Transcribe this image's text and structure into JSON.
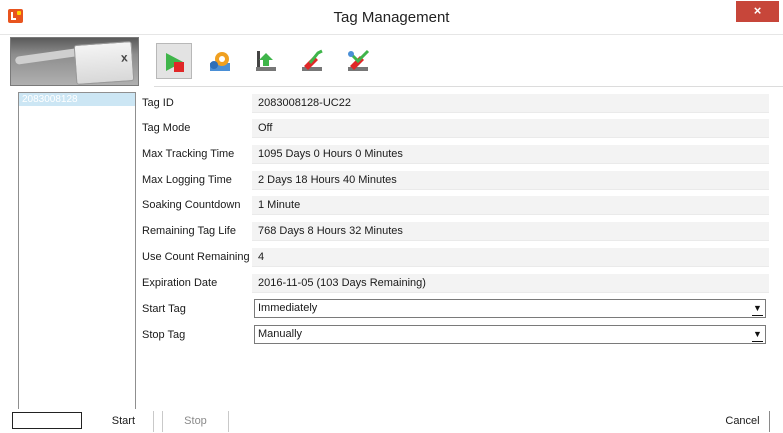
{
  "window": {
    "title": "Tag Management",
    "close_label": "×"
  },
  "toolbar": {
    "buttons": [
      {
        "name": "start-stop-tag-icon",
        "active": true
      },
      {
        "name": "configure-tag-icon",
        "active": false
      },
      {
        "name": "download-data-icon",
        "active": false
      },
      {
        "name": "clear-data-icon",
        "active": false
      },
      {
        "name": "reset-tag-icon",
        "active": false
      }
    ]
  },
  "tag_list": {
    "items": [
      "2083008128"
    ]
  },
  "properties": [
    {
      "label": "Tag ID",
      "value": "2083008128-UC22"
    },
    {
      "label": "Tag Mode",
      "value": "Off"
    },
    {
      "label": "Max Tracking Time",
      "value": "1095 Days 0 Hours 0 Minutes"
    },
    {
      "label": "Max Logging Time",
      "value": "2 Days 18 Hours 40 Minutes"
    },
    {
      "label": "Soaking Countdown",
      "value": "1 Minute"
    },
    {
      "label": "Remaining Tag Life",
      "value": "768 Days 8 Hours 32 Minutes"
    },
    {
      "label": "Use Count Remaining",
      "value": "4"
    },
    {
      "label": "Expiration Date",
      "value": "2016-11-05 (103 Days Remaining)"
    }
  ],
  "selects": {
    "start_tag": {
      "label": "Start Tag",
      "value": "Immediately"
    },
    "stop_tag": {
      "label": "Stop Tag",
      "value": "Manually"
    }
  },
  "footer": {
    "start_label": "Start",
    "stop_label": "Stop",
    "cancel_label": "Cancel"
  },
  "colors": {
    "close_button": "#c7463a",
    "selected_item": "#cce6f4",
    "app_icon": "#e8541e"
  }
}
